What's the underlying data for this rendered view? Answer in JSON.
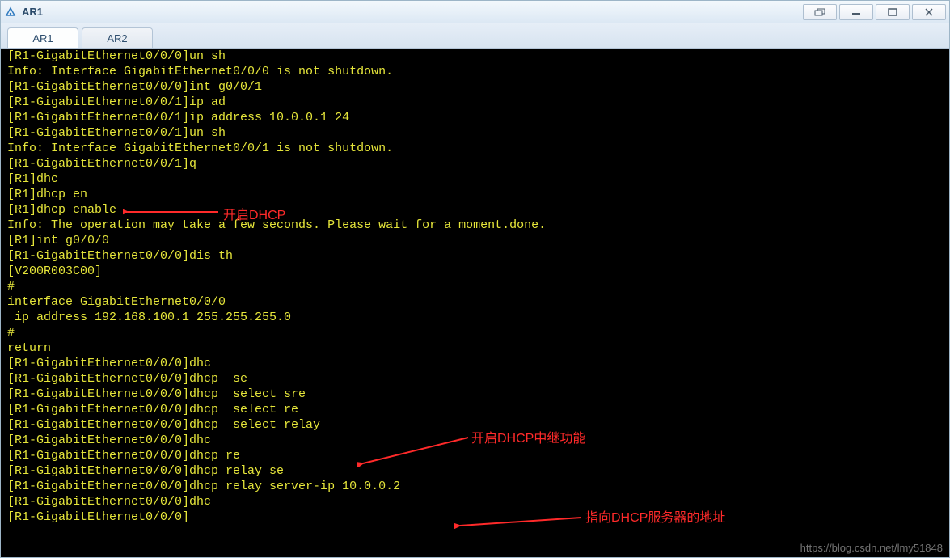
{
  "window": {
    "title": "AR1"
  },
  "tabs": [
    {
      "label": "AR1",
      "active": true
    },
    {
      "label": "AR2",
      "active": false
    }
  ],
  "terminal": {
    "lines": [
      "[R1-GigabitEthernet0/0/0]un sh",
      "Info: Interface GigabitEthernet0/0/0 is not shutdown.",
      "[R1-GigabitEthernet0/0/0]int g0/0/1",
      "[R1-GigabitEthernet0/0/1]ip ad",
      "[R1-GigabitEthernet0/0/1]ip address 10.0.0.1 24",
      "[R1-GigabitEthernet0/0/1]un sh",
      "Info: Interface GigabitEthernet0/0/1 is not shutdown.",
      "[R1-GigabitEthernet0/0/1]q",
      "[R1]dhc",
      "[R1]dhcp en",
      "[R1]dhcp enable",
      "Info: The operation may take a few seconds. Please wait for a moment.done.",
      "[R1]int g0/0/0",
      "[R1-GigabitEthernet0/0/0]dis th",
      "[V200R003C00]",
      "#",
      "interface GigabitEthernet0/0/0",
      " ip address 192.168.100.1 255.255.255.0",
      "#",
      "return",
      "[R1-GigabitEthernet0/0/0]dhc",
      "[R1-GigabitEthernet0/0/0]dhcp  se",
      "[R1-GigabitEthernet0/0/0]dhcp  select sre",
      "[R1-GigabitEthernet0/0/0]dhcp  select re",
      "[R1-GigabitEthernet0/0/0]dhcp  select relay",
      "[R1-GigabitEthernet0/0/0]dhc",
      "[R1-GigabitEthernet0/0/0]dhcp re",
      "[R1-GigabitEthernet0/0/0]dhcp relay se",
      "[R1-GigabitEthernet0/0/0]dhcp relay server-ip 10.0.0.2",
      "[R1-GigabitEthernet0/0/0]dhc",
      "[R1-GigabitEthernet0/0/0]"
    ]
  },
  "annotations": [
    {
      "text": "开启DHCP"
    },
    {
      "text": "开启DHCP中继功能"
    },
    {
      "text": "指向DHCP服务器的地址"
    }
  ],
  "watermark": "https://blog.csdn.net/lmy51848",
  "colors": {
    "terminal_fg": "#e5e53a",
    "terminal_bg": "#000000",
    "annotation": "#ff2a2a"
  }
}
